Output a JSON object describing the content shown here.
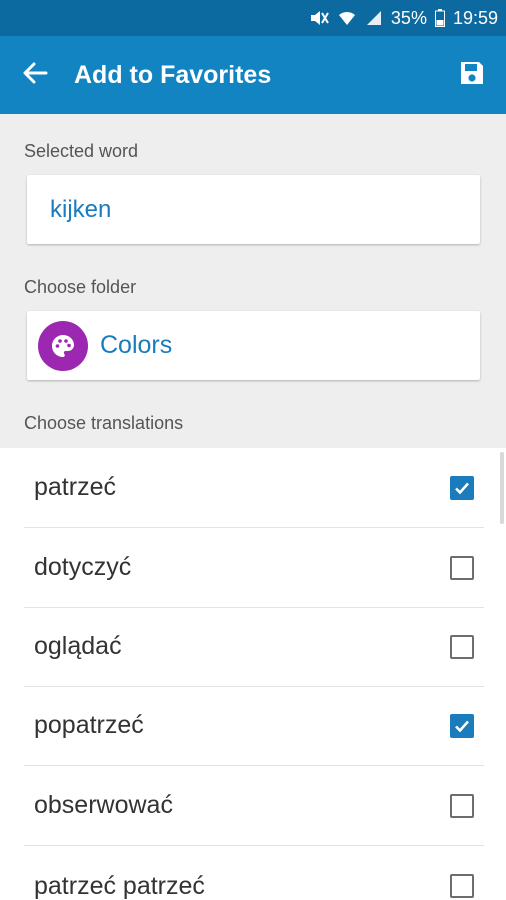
{
  "status_bar": {
    "battery": "35%",
    "time": "19:59"
  },
  "app_bar": {
    "title": "Add to Favorites"
  },
  "selected_word": {
    "label": "Selected word",
    "value": "kijken"
  },
  "folder": {
    "label": "Choose folder",
    "name": "Colors",
    "icon_color": "#9c27b0"
  },
  "translations": {
    "label": "Choose translations",
    "items": [
      {
        "text": "patrzeć",
        "checked": true
      },
      {
        "text": "dotyczyć",
        "checked": false
      },
      {
        "text": "oglądać",
        "checked": false
      },
      {
        "text": "popatrzeć",
        "checked": true
      },
      {
        "text": "obserwować",
        "checked": false
      },
      {
        "text": "patrzeć patrzeć",
        "checked": false
      }
    ]
  },
  "colors": {
    "primary": "#1284c2",
    "status_bar": "#0d6aa0",
    "accent": "#1a7bbd"
  }
}
